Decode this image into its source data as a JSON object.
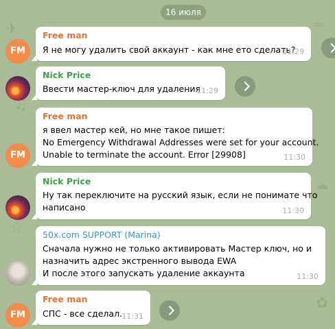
{
  "date_separator": "16 июля",
  "colors": {
    "free_man": "#e0752d",
    "nick_price": "#3aa34c",
    "support": "#3e8fcf"
  },
  "messages": [
    {
      "sender": "Free man",
      "avatar": "FM",
      "lines": [
        "Я не могу удалить свой аккаунт - как мне ето сделать?"
      ],
      "time": "11:29"
    },
    {
      "sender": "Nick Price",
      "avatar": "nick-price-avatar",
      "lines": [
        "Ввести мастер-ключ для удаления"
      ],
      "time": "11:29"
    },
    {
      "sender": "Free man",
      "avatar": "FM",
      "lines": [
        "я ввел мастер кей, но мне такое пишет:",
        "No Emergency Withdrawal Addresses were set for your account.",
        "Unable to terminate the account. Error [29908]"
      ],
      "time": "11:30"
    },
    {
      "sender": "Nick Price",
      "avatar": "nick-price-avatar",
      "lines": [
        "Ну так переключите на русский язык, если не понимате что",
        "написано"
      ],
      "time": "11:30"
    },
    {
      "sender": "50x.com SUPPORT (Marina)",
      "avatar": "support-avatar",
      "lines": [
        "Сначала нужно не только активировать Мастер ключ, но и",
        "назначить адрес экстренного вывода EWA",
        "И после этого запускать удаление аккаунта"
      ],
      "time": "11:30"
    },
    {
      "sender": "Free man",
      "avatar": "FM",
      "lines": [
        "СПС - все сделал."
      ],
      "time": "11:31"
    }
  ]
}
